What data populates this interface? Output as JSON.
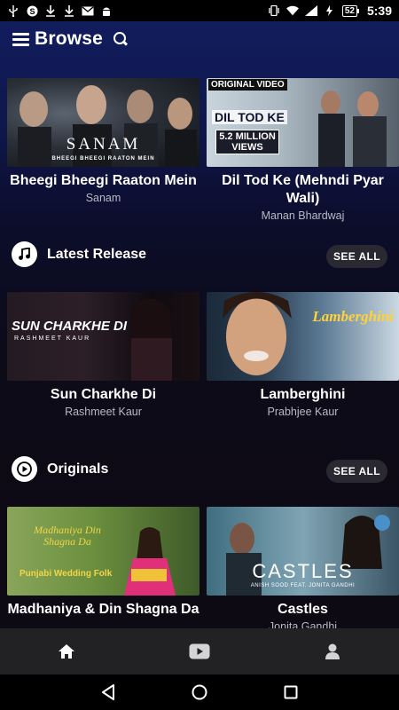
{
  "status_bar": {
    "battery": "52",
    "time": "5:39"
  },
  "header": {
    "title": "Browse"
  },
  "featured": [
    {
      "title": "Bheegi Bheegi Raaton Mein",
      "artist": "Sanam",
      "thumb_text": "SANAM",
      "thumb_sub": "BHEEGI BHEEGI RAATON MEIN"
    },
    {
      "title": "Dil Tod Ke (Mehndi Pyar Wali)",
      "artist": "Manan Bhardwaj",
      "thumb_banner": "ORIGINAL VIDEO",
      "thumb_text": "DIL TOD KE",
      "thumb_views": "5.2 MILLION VIEWS"
    }
  ],
  "sections": [
    {
      "title": "Latest Release",
      "see_all": "SEE ALL",
      "items": [
        {
          "title": "Sun Charkhe Di",
          "artist": "Rashmeet Kaur",
          "thumb_text": "SUN CHARKHE DI",
          "thumb_sub": "RASHMEET KAUR"
        },
        {
          "title": "Lamberghini",
          "artist": "Prabhjee Kaur",
          "thumb_text": "Lamberghini"
        }
      ]
    },
    {
      "title": "Originals",
      "see_all": "SEE ALL",
      "items": [
        {
          "title": "Madhaniya & Din Shagna Da",
          "artist": "",
          "thumb_text": "Madhaniya Din Shagna Da",
          "thumb_sub": "Punjabi Wedding Folk"
        },
        {
          "title": "Castles",
          "artist": "Jonita Gandhi",
          "thumb_text": "CASTLES",
          "thumb_sub": "ANISH SOOD FEAT. JONITA GANDHI"
        }
      ]
    }
  ],
  "icons": {
    "menu": "hamburger-icon",
    "search": "search-icon",
    "latest": "music-note-icon",
    "originals": "play-icon",
    "nav_home": "home-icon",
    "nav_video": "youtube-icon",
    "nav_profile": "person-icon"
  },
  "colors": {
    "header_gradient_top": "#121d5e",
    "background": "#0d0a14",
    "see_all_bg": "#2a2830",
    "bottom_nav": "#222224"
  }
}
